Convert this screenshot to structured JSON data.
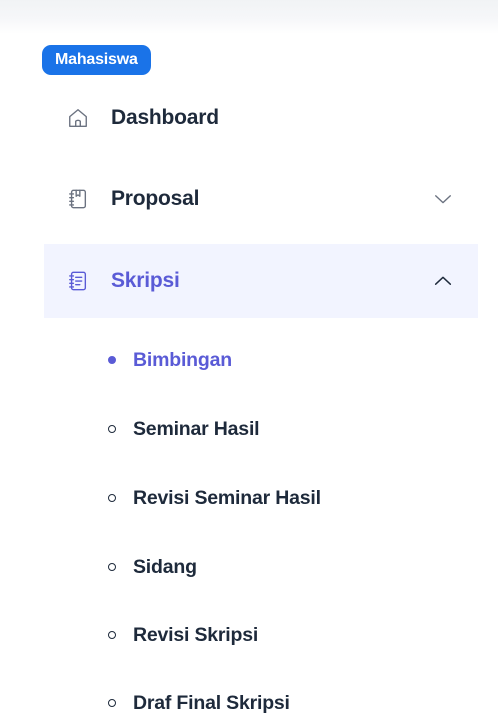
{
  "sidebar": {
    "section_label": "Mahasiswa",
    "items": [
      {
        "label": "Dashboard",
        "icon": "home-icon"
      },
      {
        "label": "Proposal",
        "icon": "book-icon",
        "chevron": "chevron-down-icon"
      },
      {
        "label": "Skripsi",
        "icon": "document-icon",
        "chevron": "chevron-up-icon",
        "active": true
      }
    ],
    "submenu": [
      {
        "label": "Bimbingan",
        "active": true
      },
      {
        "label": "Seminar Hasil"
      },
      {
        "label": "Revisi Seminar Hasil"
      },
      {
        "label": "Sidang"
      },
      {
        "label": "Revisi Skripsi"
      },
      {
        "label": "Draf Final Skripsi"
      }
    ]
  },
  "colors": {
    "badge": "#1a73e8",
    "active_text": "#5a5bd6",
    "active_bg": "#f2f4ff",
    "text": "#1e2a3b",
    "icon": "#6b7280"
  }
}
